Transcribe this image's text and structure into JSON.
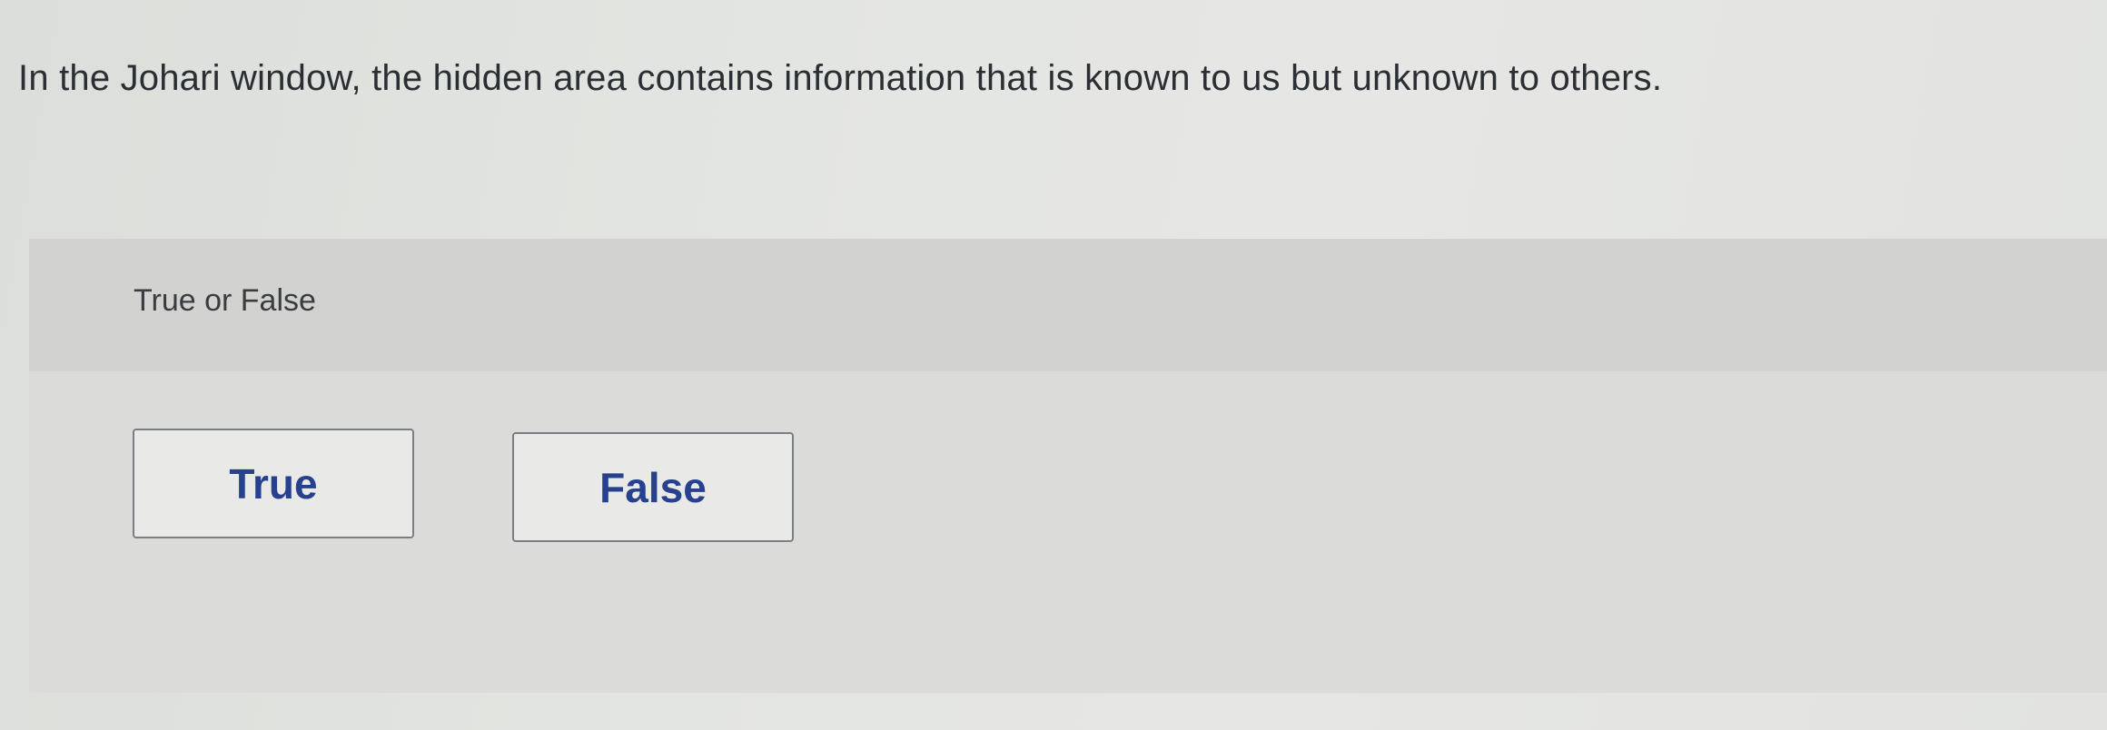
{
  "question": {
    "text": "In the Johari window, the hidden area contains information that is known to us but unknown to others."
  },
  "answer_panel": {
    "prompt": "True or False",
    "choices": [
      {
        "label": "True"
      },
      {
        "label": "False"
      }
    ]
  }
}
